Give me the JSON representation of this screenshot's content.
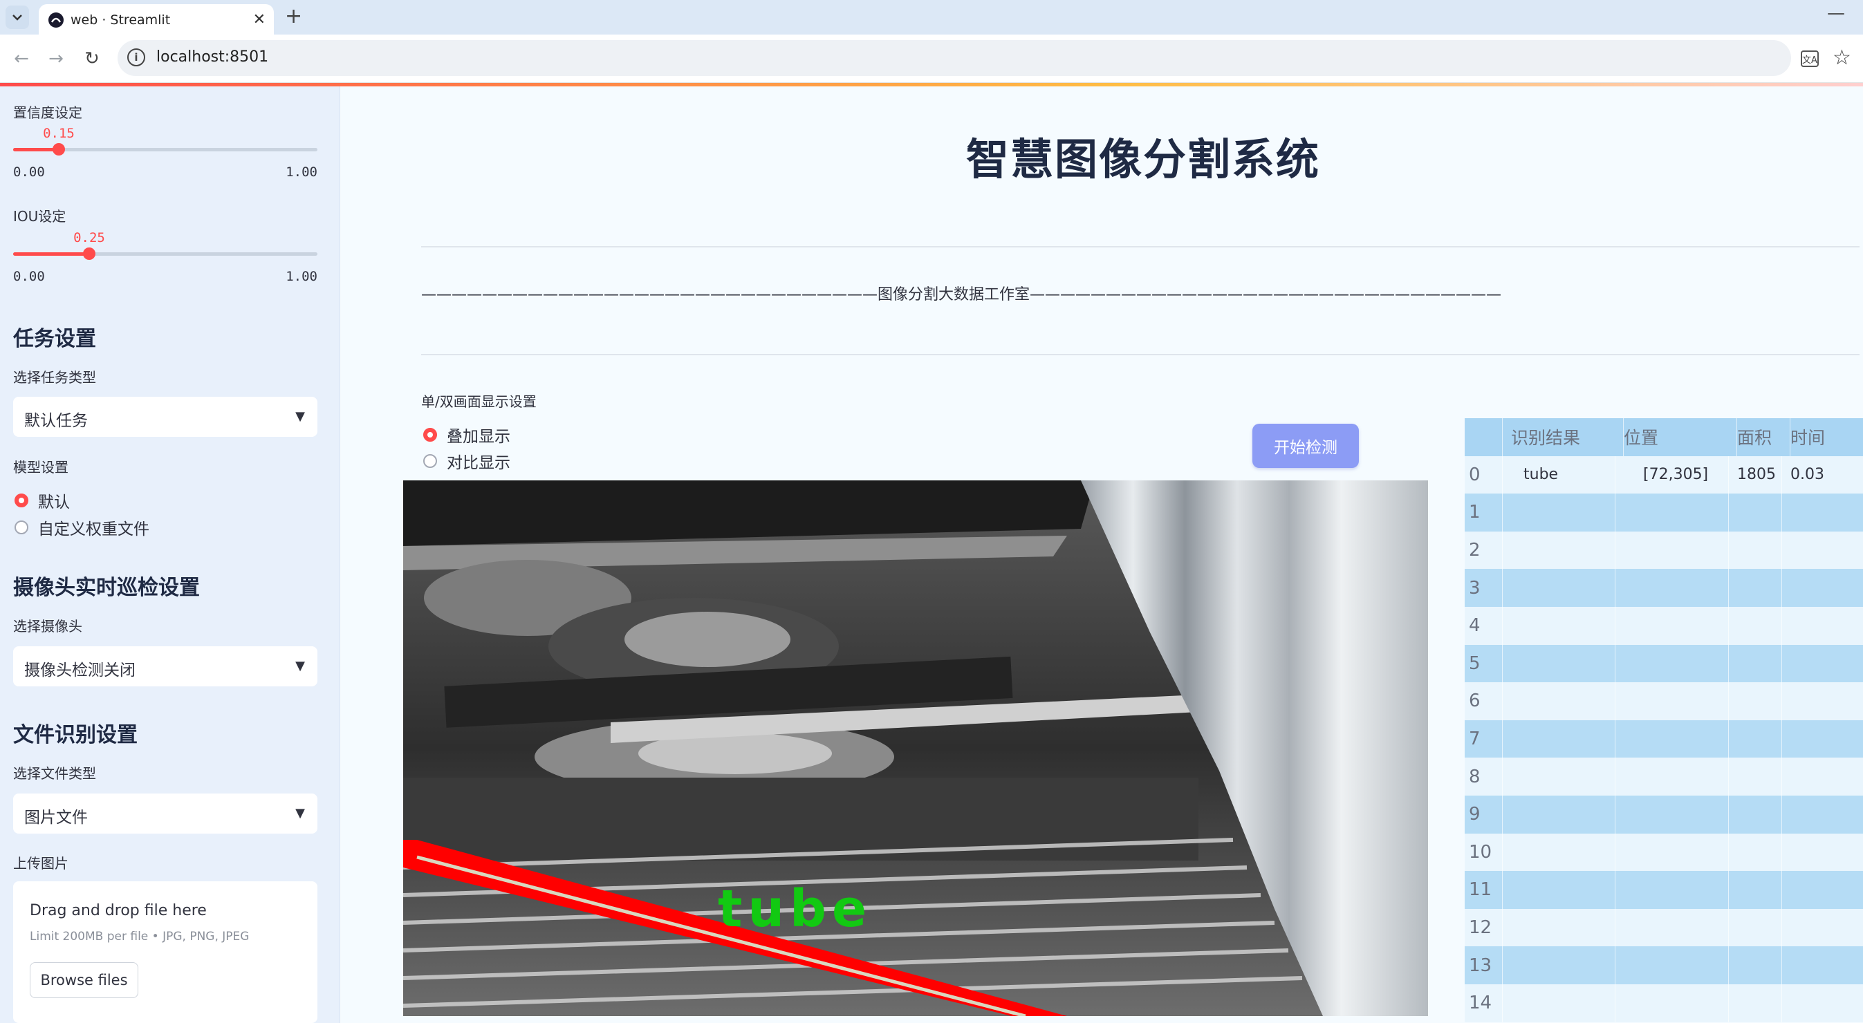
{
  "browser": {
    "tab_title": "web · Streamlit",
    "url": "localhost:8501"
  },
  "sidebar": {
    "confidence": {
      "label": "置信度设定",
      "value": "0.15",
      "min": "0.00",
      "max": "1.00",
      "fraction": 0.15
    },
    "iou": {
      "label": "IOU设定",
      "value": "0.25",
      "min": "0.00",
      "max": "1.00",
      "fraction": 0.25
    },
    "task_heading": "任务设置",
    "task_type_label": "选择任务类型",
    "task_type_value": "默认任务",
    "model_label": "模型设置",
    "model_options": [
      "默认",
      "自定义权重文件"
    ],
    "camera_heading": "摄像头实时巡检设置",
    "camera_label": "选择摄像头",
    "camera_value": "摄像头检测关闭",
    "file_heading": "文件识别设置",
    "file_type_label": "选择文件类型",
    "file_type_value": "图片文件",
    "upload_label": "上传图片",
    "upload_title": "Drag and drop file here",
    "upload_limit": "Limit 200MB per file • JPG, PNG, JPEG",
    "browse_label": "Browse files"
  },
  "main": {
    "title": "智慧图像分割系统",
    "divider_text": "——————————————————————————————图像分割大数据工作室———————————————————————————————",
    "display_label": "单/双画面显示设置",
    "display_options": [
      "叠加显示",
      "对比显示"
    ],
    "start_button": "开始检测",
    "detection_label": "tube"
  },
  "table": {
    "headers": [
      "识别结果",
      "位置",
      "面积",
      "时间"
    ],
    "rows": [
      {
        "index": "0",
        "result": "tube",
        "position": "[72,305]",
        "area": "1805",
        "time": "0.03"
      },
      {
        "index": "1",
        "result": "",
        "position": "",
        "area": "",
        "time": ""
      },
      {
        "index": "2",
        "result": "",
        "position": "",
        "area": "",
        "time": ""
      },
      {
        "index": "3",
        "result": "",
        "position": "",
        "area": "",
        "time": ""
      },
      {
        "index": "4",
        "result": "",
        "position": "",
        "area": "",
        "time": ""
      },
      {
        "index": "5",
        "result": "",
        "position": "",
        "area": "",
        "time": ""
      },
      {
        "index": "6",
        "result": "",
        "position": "",
        "area": "",
        "time": ""
      },
      {
        "index": "7",
        "result": "",
        "position": "",
        "area": "",
        "time": ""
      },
      {
        "index": "8",
        "result": "",
        "position": "",
        "area": "",
        "time": ""
      },
      {
        "index": "9",
        "result": "",
        "position": "",
        "area": "",
        "time": ""
      },
      {
        "index": "10",
        "result": "",
        "position": "",
        "area": "",
        "time": ""
      },
      {
        "index": "11",
        "result": "",
        "position": "",
        "area": "",
        "time": ""
      },
      {
        "index": "12",
        "result": "",
        "position": "",
        "area": "",
        "time": ""
      },
      {
        "index": "13",
        "result": "",
        "position": "",
        "area": "",
        "time": ""
      },
      {
        "index": "14",
        "result": "",
        "position": "",
        "area": "",
        "time": ""
      }
    ]
  },
  "colors": {
    "accent": "#ff4b4b",
    "button": "#8c9cf5",
    "sidebar_bg": "#e8f0fb",
    "table_stripe": "#b5dcf5",
    "detection_box": "#ff0000",
    "detection_text": "#00c000"
  }
}
